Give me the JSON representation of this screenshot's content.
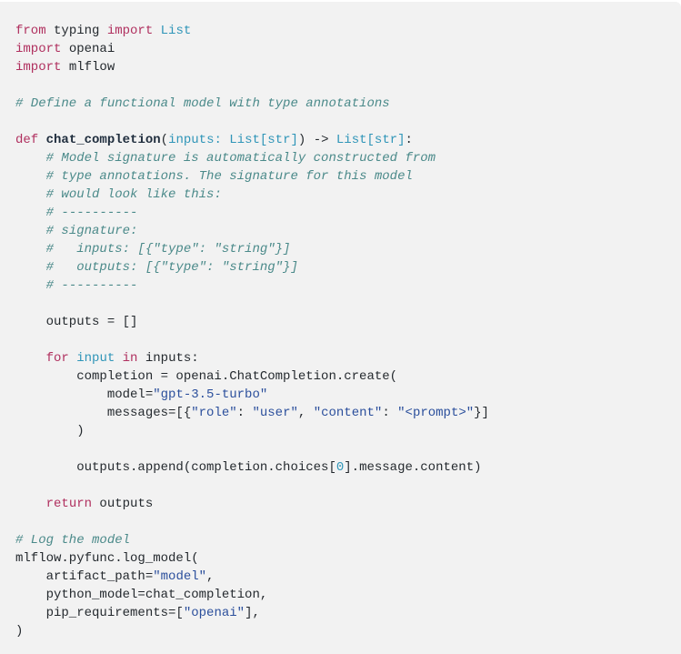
{
  "code_block": {
    "language": "python",
    "colors": {
      "background": "#f2f2f2",
      "keyword": "#b0305f",
      "builtin": "#2f95b8",
      "string": "#2b4f9c",
      "comment": "#4b8a8a",
      "text": "#24292e"
    },
    "lines": [
      [
        {
          "t": "kw",
          "v": "from"
        },
        {
          "t": "tx",
          "v": " typing "
        },
        {
          "t": "kw",
          "v": "import"
        },
        {
          "t": "tx",
          "v": " "
        },
        {
          "t": "bi",
          "v": "List"
        }
      ],
      [
        {
          "t": "kw",
          "v": "import"
        },
        {
          "t": "tx",
          "v": " openai"
        }
      ],
      [
        {
          "t": "kw",
          "v": "import"
        },
        {
          "t": "tx",
          "v": " mlflow"
        }
      ],
      [],
      [
        {
          "t": "cm",
          "v": "# Define a functional model with type annotations"
        }
      ],
      [],
      [
        {
          "t": "kw",
          "v": "def"
        },
        {
          "t": "tx",
          "v": " "
        },
        {
          "t": "fn",
          "v": "chat_completion"
        },
        {
          "t": "tx",
          "v": "("
        },
        {
          "t": "bi",
          "v": "inputs: List[str]"
        },
        {
          "t": "tx",
          "v": ") -> "
        },
        {
          "t": "bi",
          "v": "List[str]"
        },
        {
          "t": "tx",
          "v": ":"
        }
      ],
      [
        {
          "t": "tx",
          "v": "    "
        },
        {
          "t": "cm",
          "v": "# Model signature is automatically constructed from"
        }
      ],
      [
        {
          "t": "tx",
          "v": "    "
        },
        {
          "t": "cm",
          "v": "# type annotations. The signature for this model"
        }
      ],
      [
        {
          "t": "tx",
          "v": "    "
        },
        {
          "t": "cm",
          "v": "# would look like this:"
        }
      ],
      [
        {
          "t": "tx",
          "v": "    "
        },
        {
          "t": "cm",
          "v": "# ----------"
        }
      ],
      [
        {
          "t": "tx",
          "v": "    "
        },
        {
          "t": "cm",
          "v": "# signature:"
        }
      ],
      [
        {
          "t": "tx",
          "v": "    "
        },
        {
          "t": "cm",
          "v": "#   inputs: [{\"type\": \"string\"}]"
        }
      ],
      [
        {
          "t": "tx",
          "v": "    "
        },
        {
          "t": "cm",
          "v": "#   outputs: [{\"type\": \"string\"}]"
        }
      ],
      [
        {
          "t": "tx",
          "v": "    "
        },
        {
          "t": "cm",
          "v": "# ----------"
        }
      ],
      [],
      [
        {
          "t": "tx",
          "v": "    outputs = []"
        }
      ],
      [],
      [
        {
          "t": "tx",
          "v": "    "
        },
        {
          "t": "kw",
          "v": "for"
        },
        {
          "t": "tx",
          "v": " "
        },
        {
          "t": "bi",
          "v": "input"
        },
        {
          "t": "tx",
          "v": " "
        },
        {
          "t": "kw",
          "v": "in"
        },
        {
          "t": "tx",
          "v": " inputs:"
        }
      ],
      [
        {
          "t": "tx",
          "v": "        completion = openai.ChatCompletion.create("
        }
      ],
      [
        {
          "t": "tx",
          "v": "            model="
        },
        {
          "t": "str",
          "v": "\"gpt-3.5-turbo\""
        }
      ],
      [
        {
          "t": "tx",
          "v": "            messages=[{"
        },
        {
          "t": "str",
          "v": "\"role\""
        },
        {
          "t": "tx",
          "v": ": "
        },
        {
          "t": "str",
          "v": "\"user\""
        },
        {
          "t": "tx",
          "v": ", "
        },
        {
          "t": "str",
          "v": "\"content\""
        },
        {
          "t": "tx",
          "v": ": "
        },
        {
          "t": "str",
          "v": "\"<prompt>\""
        },
        {
          "t": "tx",
          "v": "}]"
        }
      ],
      [
        {
          "t": "tx",
          "v": "        )"
        }
      ],
      [],
      [
        {
          "t": "tx",
          "v": "        outputs.append(completion.choices["
        },
        {
          "t": "num",
          "v": "0"
        },
        {
          "t": "tx",
          "v": "].message.content)"
        }
      ],
      [],
      [
        {
          "t": "tx",
          "v": "    "
        },
        {
          "t": "kw",
          "v": "return"
        },
        {
          "t": "tx",
          "v": " outputs"
        }
      ],
      [],
      [
        {
          "t": "cm",
          "v": "# Log the model"
        }
      ],
      [
        {
          "t": "tx",
          "v": "mlflow.pyfunc.log_model("
        }
      ],
      [
        {
          "t": "tx",
          "v": "    artifact_path="
        },
        {
          "t": "str",
          "v": "\"model\""
        },
        {
          "t": "tx",
          "v": ","
        }
      ],
      [
        {
          "t": "tx",
          "v": "    python_model=chat_completion,"
        }
      ],
      [
        {
          "t": "tx",
          "v": "    pip_requirements=["
        },
        {
          "t": "str",
          "v": "\"openai\""
        },
        {
          "t": "tx",
          "v": "],"
        }
      ],
      [
        {
          "t": "tx",
          "v": ")"
        }
      ]
    ]
  }
}
